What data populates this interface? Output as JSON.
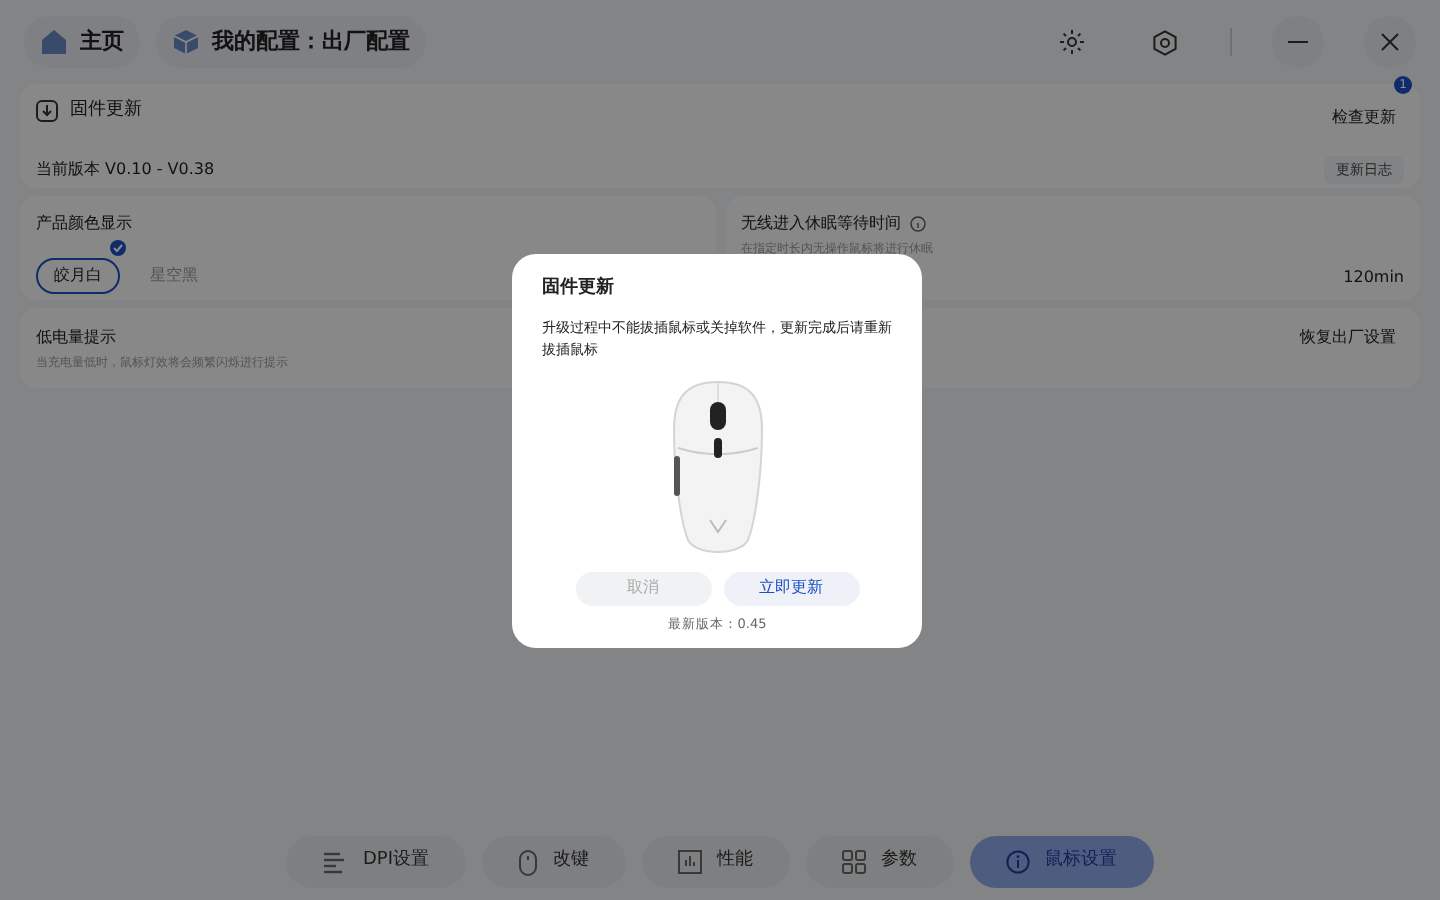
{
  "header": {
    "home": "主页",
    "profile": "我的配置：出厂配置"
  },
  "firmware_card": {
    "title": "固件更新",
    "check_button": "检查更新",
    "badge": "1",
    "current_version": "当前版本 V0.10 - V0.38",
    "changelog_button": "更新日志"
  },
  "color_card": {
    "title": "产品颜色显示",
    "options": [
      {
        "label": "皎月白",
        "selected": true
      },
      {
        "label": "星空黑",
        "selected": false
      }
    ]
  },
  "sleep_card": {
    "title": "无线进入休眠等待时间",
    "hint": "在指定时长内无操作鼠标将进行休眠",
    "reading": "120min"
  },
  "battery_card": {
    "title": "低电量提示",
    "hint": "当充电量低时，鼠标灯效将会频繁闪烁进行提示",
    "reset_button": "恢复出厂设置"
  },
  "dialog": {
    "title": "固件更新",
    "message": "升级过程中不能拔插鼠标或关掉软件，更新完成后请重新拔插鼠标",
    "buttons": [
      {
        "label": "取消",
        "disabled": true
      },
      {
        "label": "立即更新",
        "disabled": false
      }
    ],
    "latest_version": "最新版本：0.45"
  },
  "nav": [
    {
      "label": "DPI设置",
      "kind": "bars",
      "selected": false
    },
    {
      "label": "改键",
      "kind": "mouse",
      "selected": false
    },
    {
      "label": "性能",
      "kind": "chart",
      "selected": false
    },
    {
      "label": "参数",
      "kind": "grid",
      "selected": false
    },
    {
      "label": "鼠标设置",
      "kind": "info",
      "selected": true
    }
  ]
}
